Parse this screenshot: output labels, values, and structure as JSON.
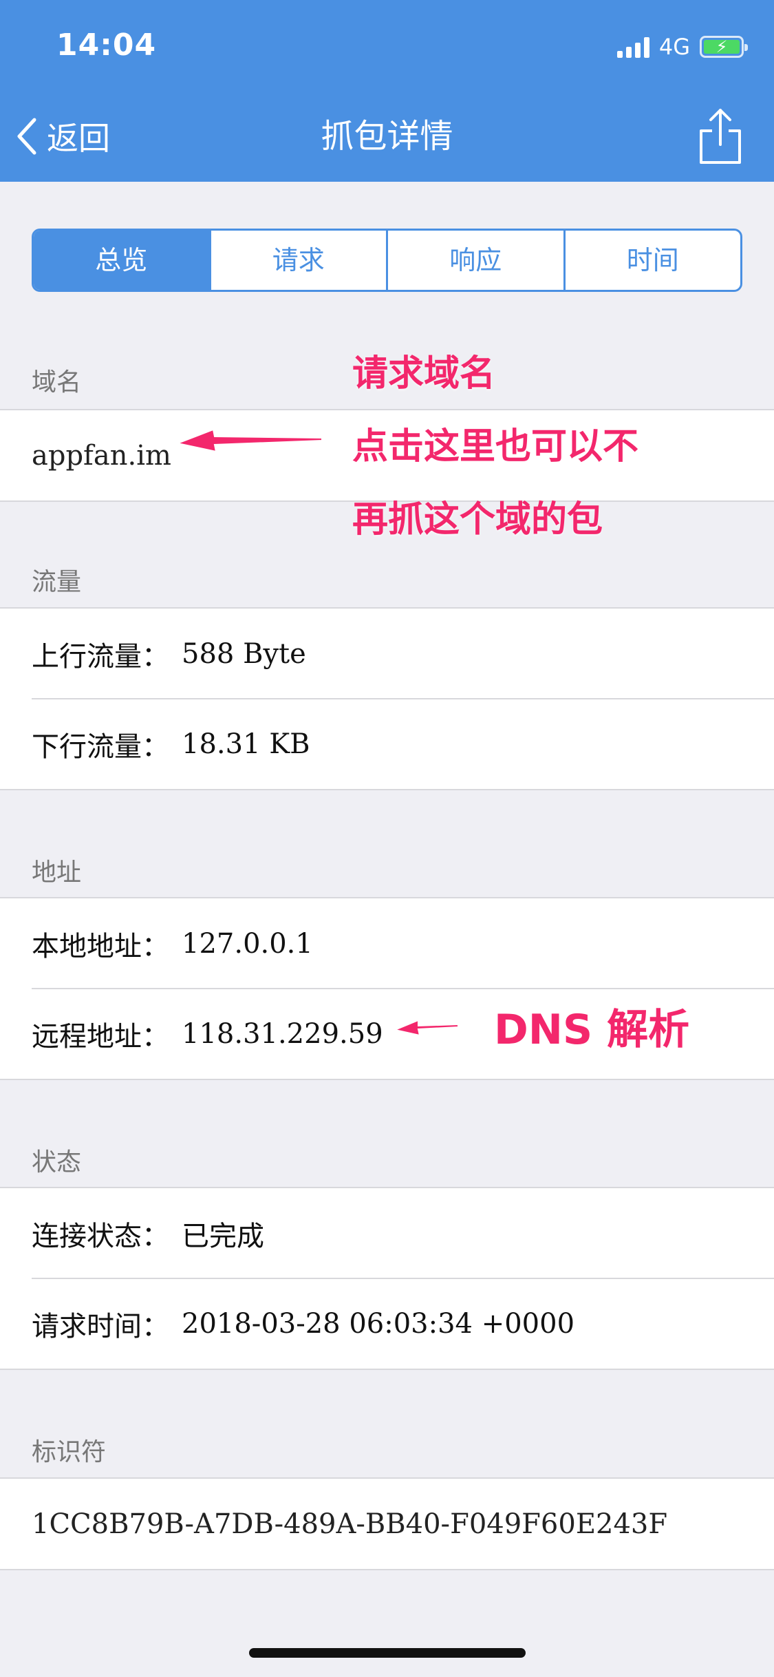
{
  "status_bar": {
    "time": "14:04",
    "network": "4G",
    "battery_color": "#4cd964"
  },
  "nav": {
    "back_label": "返回",
    "title": "抓包详情",
    "back_icon": "chevron-left-icon",
    "share_icon": "share-icon"
  },
  "tabs": [
    {
      "label": "总览",
      "active": true
    },
    {
      "label": "请求",
      "active": false
    },
    {
      "label": "响应",
      "active": false
    },
    {
      "label": "时间",
      "active": false
    }
  ],
  "sections": {
    "domain": {
      "header": "域名",
      "value": "appfan.im"
    },
    "traffic": {
      "header": "流量",
      "rows": [
        {
          "label": "上行流量：",
          "value": "588 Byte"
        },
        {
          "label": "下行流量：",
          "value": "18.31 KB"
        }
      ]
    },
    "address": {
      "header": "地址",
      "rows": [
        {
          "label": "本地地址：",
          "value": "127.0.0.1"
        },
        {
          "label": "远程地址：",
          "value": "118.31.229.59"
        }
      ]
    },
    "status": {
      "header": "状态",
      "rows": [
        {
          "label": "连接状态：",
          "value": "已完成"
        },
        {
          "label": "请求时间：",
          "value": "2018-03-28 06:03:34 +0000"
        }
      ]
    },
    "identifier": {
      "header": "标识符",
      "value": "1CC8B79B-A7DB-489A-BB40-F049F60E243F"
    }
  },
  "annotations": {
    "domain_lines": [
      "请求域名",
      "点击这里也可以不",
      "再抓这个域的包"
    ],
    "dns": "DNS 解析",
    "color": "#f3276c"
  },
  "colors": {
    "accent": "#4a90e2",
    "background": "#efeff4"
  }
}
